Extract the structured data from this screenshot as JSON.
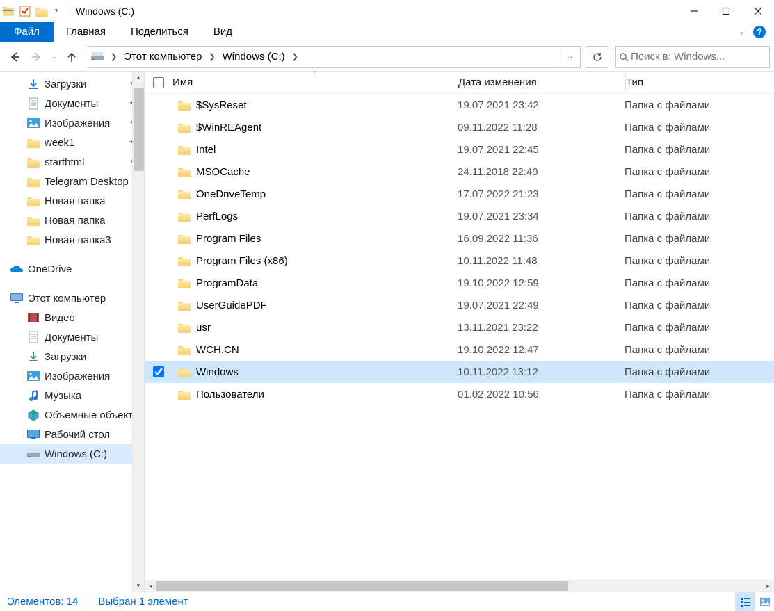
{
  "window": {
    "title": "Windows (C:)"
  },
  "ribbon": {
    "file_label": "Файл",
    "tabs": [
      {
        "label": "Главная"
      },
      {
        "label": "Поделиться"
      },
      {
        "label": "Вид"
      }
    ]
  },
  "address": {
    "segments": [
      {
        "label": "Этот компьютер"
      },
      {
        "label": "Windows (C:)"
      }
    ]
  },
  "search": {
    "placeholder": "Поиск в: Windows..."
  },
  "sidebar": {
    "items": [
      {
        "label": "Загрузки",
        "icon": "downloads",
        "pinned": true,
        "indent": 1
      },
      {
        "label": "Документы",
        "icon": "documents",
        "pinned": true,
        "indent": 1
      },
      {
        "label": "Изображения",
        "icon": "pictures",
        "pinned": true,
        "indent": 1
      },
      {
        "label": "week1",
        "icon": "folder",
        "pinned": true,
        "indent": 1
      },
      {
        "label": "starthtml",
        "icon": "folder",
        "pinned": true,
        "indent": 1
      },
      {
        "label": "Telegram Desktop",
        "icon": "folder",
        "pinned": false,
        "indent": 1
      },
      {
        "label": "Новая папка",
        "icon": "folder",
        "pinned": false,
        "indent": 1
      },
      {
        "label": "Новая папка",
        "icon": "folder",
        "pinned": false,
        "indent": 1
      },
      {
        "label": "Новая папка3",
        "icon": "folder",
        "pinned": false,
        "indent": 1
      },
      {
        "label": "OneDrive",
        "icon": "onedrive",
        "pinned": false,
        "indent": 0,
        "spacer_above": true
      },
      {
        "label": "Этот компьютер",
        "icon": "computer",
        "pinned": false,
        "indent": 0,
        "spacer_above": true
      },
      {
        "label": "Видео",
        "icon": "video",
        "pinned": false,
        "indent": 1
      },
      {
        "label": "Документы",
        "icon": "documents",
        "pinned": false,
        "indent": 1
      },
      {
        "label": "Загрузки",
        "icon": "downloads2",
        "pinned": false,
        "indent": 1
      },
      {
        "label": "Изображения",
        "icon": "pictures",
        "pinned": false,
        "indent": 1
      },
      {
        "label": "Музыка",
        "icon": "music",
        "pinned": false,
        "indent": 1
      },
      {
        "label": "Объемные объекты",
        "icon": "3d",
        "pinned": false,
        "indent": 1
      },
      {
        "label": "Рабочий стол",
        "icon": "desktop",
        "pinned": false,
        "indent": 1
      },
      {
        "label": "Windows (C:)",
        "icon": "drive",
        "pinned": false,
        "indent": 1,
        "selected": true
      }
    ]
  },
  "columns": {
    "name": "Имя",
    "date": "Дата изменения",
    "type": "Тип"
  },
  "files": [
    {
      "name": "$SysReset",
      "date": "19.07.2021 23:42",
      "type": "Папка с файлами"
    },
    {
      "name": "$WinREAgent",
      "date": "09.11.2022 11:28",
      "type": "Папка с файлами"
    },
    {
      "name": "Intel",
      "date": "19.07.2021 22:45",
      "type": "Папка с файлами"
    },
    {
      "name": "MSOCache",
      "date": "24.11.2018 22:49",
      "type": "Папка с файлами"
    },
    {
      "name": "OneDriveTemp",
      "date": "17.07.2022 21:23",
      "type": "Папка с файлами"
    },
    {
      "name": "PerfLogs",
      "date": "19.07.2021 23:34",
      "type": "Папка с файлами"
    },
    {
      "name": "Program Files",
      "date": "16.09.2022 11:36",
      "type": "Папка с файлами"
    },
    {
      "name": "Program Files (x86)",
      "date": "10.11.2022 11:48",
      "type": "Папка с файлами"
    },
    {
      "name": "ProgramData",
      "date": "19.10.2022 12:59",
      "type": "Папка с файлами"
    },
    {
      "name": "UserGuidePDF",
      "date": "19.07.2021 22:49",
      "type": "Папка с файлами"
    },
    {
      "name": "usr",
      "date": "13.11.2021 23:22",
      "type": "Папка с файлами"
    },
    {
      "name": "WCH.CN",
      "date": "19.10.2022 12:47",
      "type": "Папка с файлами"
    },
    {
      "name": "Windows",
      "date": "10.11.2022 13:12",
      "type": "Папка с файлами",
      "selected": true
    },
    {
      "name": "Пользователи",
      "date": "01.02.2022 10:56",
      "type": "Папка с файлами"
    }
  ],
  "status": {
    "count_label": "Элементов: 14",
    "selection_label": "Выбран 1 элемент"
  }
}
